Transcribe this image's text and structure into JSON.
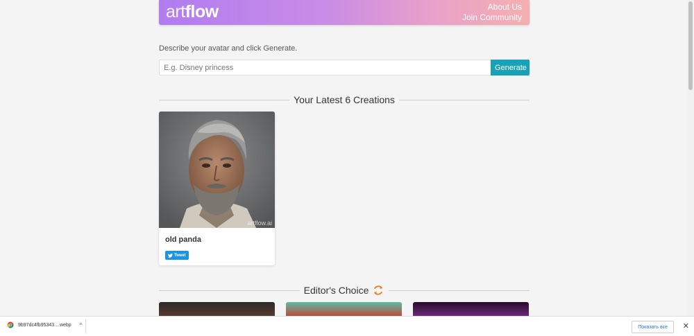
{
  "header": {
    "logo_part1": "art",
    "logo_part2": "flow",
    "nav": {
      "about": "About Us",
      "community": "Join Community"
    }
  },
  "generator": {
    "prompt": "Describe your avatar and click Generate.",
    "placeholder": "E.g. Disney princess",
    "button_label": "Generate"
  },
  "creations": {
    "heading": "Your Latest 6 Creations",
    "items": [
      {
        "title": "old panda",
        "watermark": "artflow.ai",
        "tweet_label": "Tweet"
      }
    ]
  },
  "editors_choice": {
    "heading": "Editor's Choice",
    "icon": "refresh-icon",
    "icon_color": "#f47b20"
  },
  "download_bar": {
    "file_name": "9b97dc4fb95343....webp",
    "show_all_label": "Показать все"
  },
  "colors": {
    "accent": "#17a2b8",
    "twitter": "#1b95e0",
    "header_gradient_start": "#b07cf0",
    "header_gradient_end": "#f4b0b0"
  }
}
